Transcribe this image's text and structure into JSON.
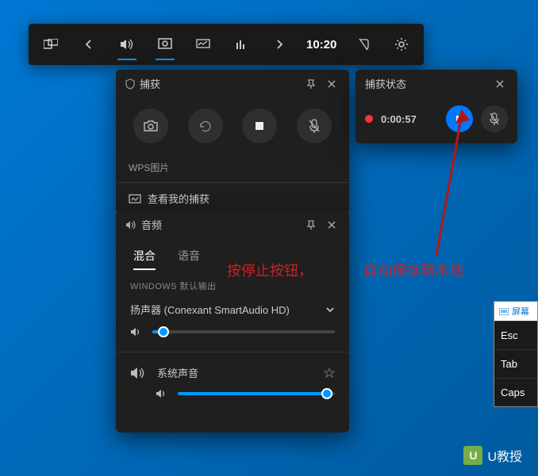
{
  "gamebar": {
    "time": "10:20"
  },
  "capture": {
    "title": "捕获",
    "app_label": "WPS图片",
    "view_captures": "查看我的捕获"
  },
  "status": {
    "title": "捕获状态",
    "timer": "0:00:57"
  },
  "audio": {
    "title": "音频",
    "tab_mix": "混合",
    "tab_voice": "语音",
    "section_win": "WINDOWS 默认输出",
    "device": "扬声器 (Conexant SmartAudio HD)",
    "system_sound": "系统声音",
    "speaker_vol_pct": 6,
    "system_vol_pct": 95,
    "bottom_cut": "屏幕键盘"
  },
  "annotations": {
    "press_stop": "按停止按钮，",
    "auto_save": "自动保存到本地"
  },
  "osk": {
    "title": "屏幕",
    "keys": [
      "Esc",
      "Tab",
      "Caps"
    ]
  },
  "watermark": "U教授"
}
